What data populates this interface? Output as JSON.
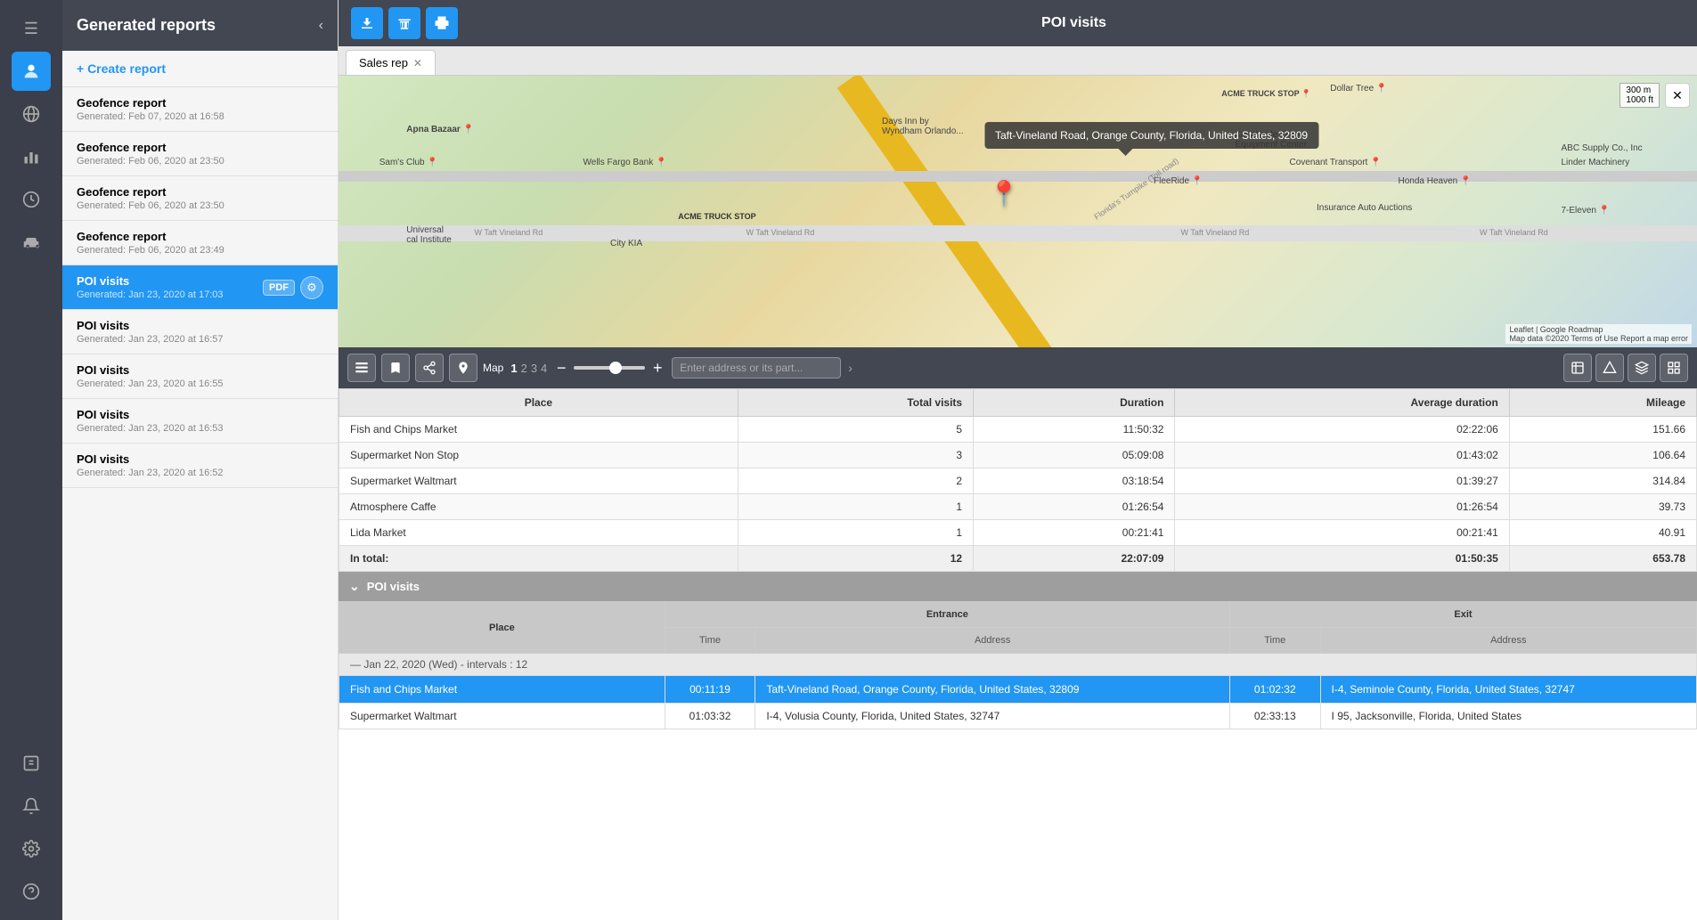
{
  "app": {
    "title": "POI visits"
  },
  "leftNav": {
    "icons": [
      {
        "name": "menu-icon",
        "symbol": "≡",
        "active": false
      },
      {
        "name": "user-icon",
        "symbol": "👤",
        "active": true
      },
      {
        "name": "globe-icon",
        "symbol": "🌐",
        "active": false
      },
      {
        "name": "chart-icon",
        "symbol": "📊",
        "active": false
      },
      {
        "name": "clock-icon",
        "symbol": "🕐",
        "active": false
      },
      {
        "name": "car-icon",
        "symbol": "🚗",
        "active": false
      },
      {
        "name": "login-icon",
        "symbol": "⬡",
        "active": false
      },
      {
        "name": "bell-icon",
        "symbol": "🔔",
        "active": false
      },
      {
        "name": "settings-icon",
        "symbol": "⚙",
        "active": false
      },
      {
        "name": "help-icon",
        "symbol": "?",
        "active": false
      }
    ]
  },
  "sidebar": {
    "title": "Generated reports",
    "createLabel": "+ Create report",
    "reports": [
      {
        "name": "Geofence report",
        "date": "Generated: Feb 07, 2020 at 16:58",
        "active": false
      },
      {
        "name": "Geofence report",
        "date": "Generated: Feb 06, 2020 at 23:50",
        "active": false
      },
      {
        "name": "Geofence report",
        "date": "Generated: Feb 06, 2020 at 23:50",
        "active": false
      },
      {
        "name": "Geofence report",
        "date": "Generated: Feb 06, 2020 at 23:49",
        "active": false
      },
      {
        "name": "POI visits",
        "date": "Generated: Jan 23, 2020 at 17:03",
        "active": true
      },
      {
        "name": "POI visits",
        "date": "Generated: Jan 23, 2020 at 16:57",
        "active": false
      },
      {
        "name": "POI visits",
        "date": "Generated: Jan 23, 2020 at 16:55",
        "active": false
      },
      {
        "name": "POI visits",
        "date": "Generated: Jan 23, 2020 at 16:53",
        "active": false
      },
      {
        "name": "POI visits",
        "date": "Generated: Jan 23, 2020 at 16:52",
        "active": false
      }
    ]
  },
  "toolbar": {
    "download_label": "⬇",
    "delete_label": "🗑",
    "print_label": "🖨",
    "title": "POI visits"
  },
  "tab": {
    "label": "Sales rep"
  },
  "map": {
    "tooltip": "Taft-Vineland Road, Orange County, Florida, United States, 32809",
    "scale_m": "300 m",
    "scale_ft": "1000 ft",
    "attribution": "Leaflet | Google Roadmap",
    "attribution2": "Map data ©2020  Terms of Use  Report a map error",
    "search_placeholder": "Enter address or its part...",
    "pages": [
      "1",
      "2",
      "3",
      "4"
    ],
    "active_page": "1"
  },
  "summaryTable": {
    "columns": [
      "Place",
      "Total visits",
      "Duration",
      "Average duration",
      "Mileage"
    ],
    "rows": [
      {
        "place": "Fish and Chips Market",
        "visits": "5",
        "duration": "11:50:32",
        "avg": "02:22:06",
        "mileage": "151.66"
      },
      {
        "place": "Supermarket Non Stop",
        "visits": "3",
        "duration": "05:09:08",
        "avg": "01:43:02",
        "mileage": "106.64"
      },
      {
        "place": "Supermarket Waltmart",
        "visits": "2",
        "duration": "03:18:54",
        "avg": "01:39:27",
        "mileage": "314.84"
      },
      {
        "place": "Atmosphere Caffe",
        "visits": "1",
        "duration": "01:26:54",
        "avg": "01:26:54",
        "mileage": "39.73"
      },
      {
        "place": "Lida Market",
        "visits": "1",
        "duration": "00:21:41",
        "avg": "00:21:41",
        "mileage": "40.91"
      }
    ],
    "total": {
      "label": "In total:",
      "visits": "12",
      "duration": "22:07:09",
      "avg": "01:50:35",
      "mileage": "653.78"
    }
  },
  "poiSection": {
    "title": "POI visits",
    "columns": {
      "place": "Place",
      "entrance": "Entrance",
      "exit": "Exit",
      "time": "Time",
      "address": "Address"
    },
    "dateRow": "— Jan 22, 2020 (Wed) - intervals : 12",
    "highlightRow": {
      "place": "Fish and Chips Market",
      "entranceTime": "00:11:19",
      "entranceAddress": "Taft-Vineland Road, Orange County, Florida, United States, 32809",
      "exitTime": "01:02:32",
      "exitAddress": "I-4, Seminole County, Florida, United States, 32747"
    },
    "row2": {
      "place": "Supermarket Waltmart",
      "entranceTime": "01:03:32",
      "entranceAddress": "I-4, Volusia County, Florida, United States, 32747",
      "exitTime": "02:33:13",
      "exitAddress": "I 95, Jacksonville, Florida, United States"
    }
  }
}
